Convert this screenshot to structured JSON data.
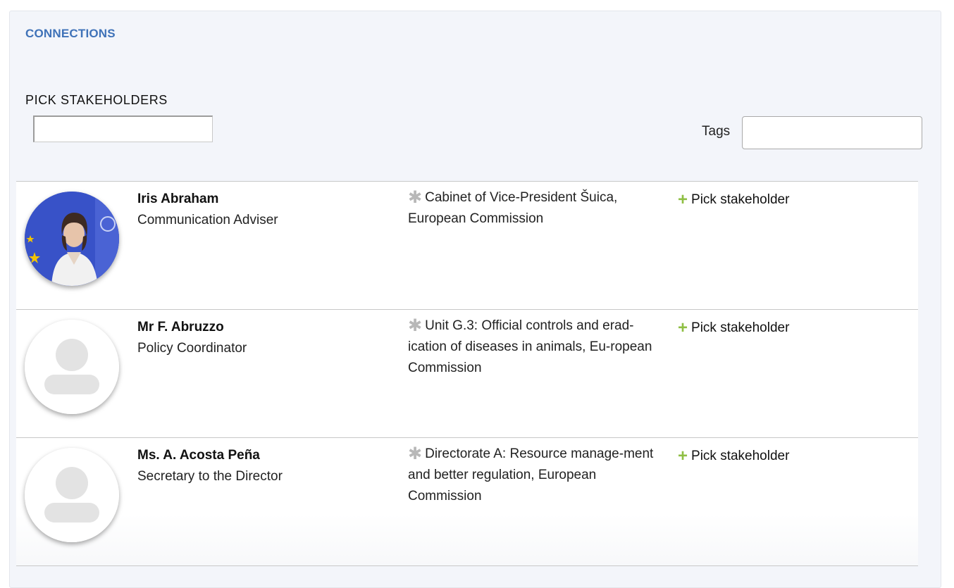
{
  "section": {
    "title": "CONNECTIONS"
  },
  "pick": {
    "label": "PICK STAKEHOLDERS",
    "value": ""
  },
  "tags": {
    "label": "Tags",
    "value": ""
  },
  "people": [
    {
      "name": "Iris Abraham",
      "role": "Communication Adviser",
      "org": "Cabinet of Vice-President Šuica, European Commission",
      "action": "Pick stakeholder",
      "avatar": "photo"
    },
    {
      "name": "Mr F. Abruzzo",
      "role": "Policy Coordinator",
      "org": "Unit G.3: Official controls and erad-ication of diseases in animals, Eu-ropean Commission",
      "action": "Pick stakeholder",
      "avatar": "placeholder-person-icon"
    },
    {
      "name": "Ms. A. Acosta Peña",
      "role": "Secretary to the Director",
      "org": "Directorate A: Resource manage-ment and better regulation, European Commission",
      "action": "Pick stakeholder",
      "avatar": "placeholder-person-icon"
    }
  ],
  "icons": {
    "org": "asterisk-icon",
    "pick": "plus-icon"
  },
  "colors": {
    "accent": "#3f72b8",
    "plus": "#8fbf44",
    "asterisk": "#b8b8b8",
    "panel": "#f3f5fa"
  }
}
